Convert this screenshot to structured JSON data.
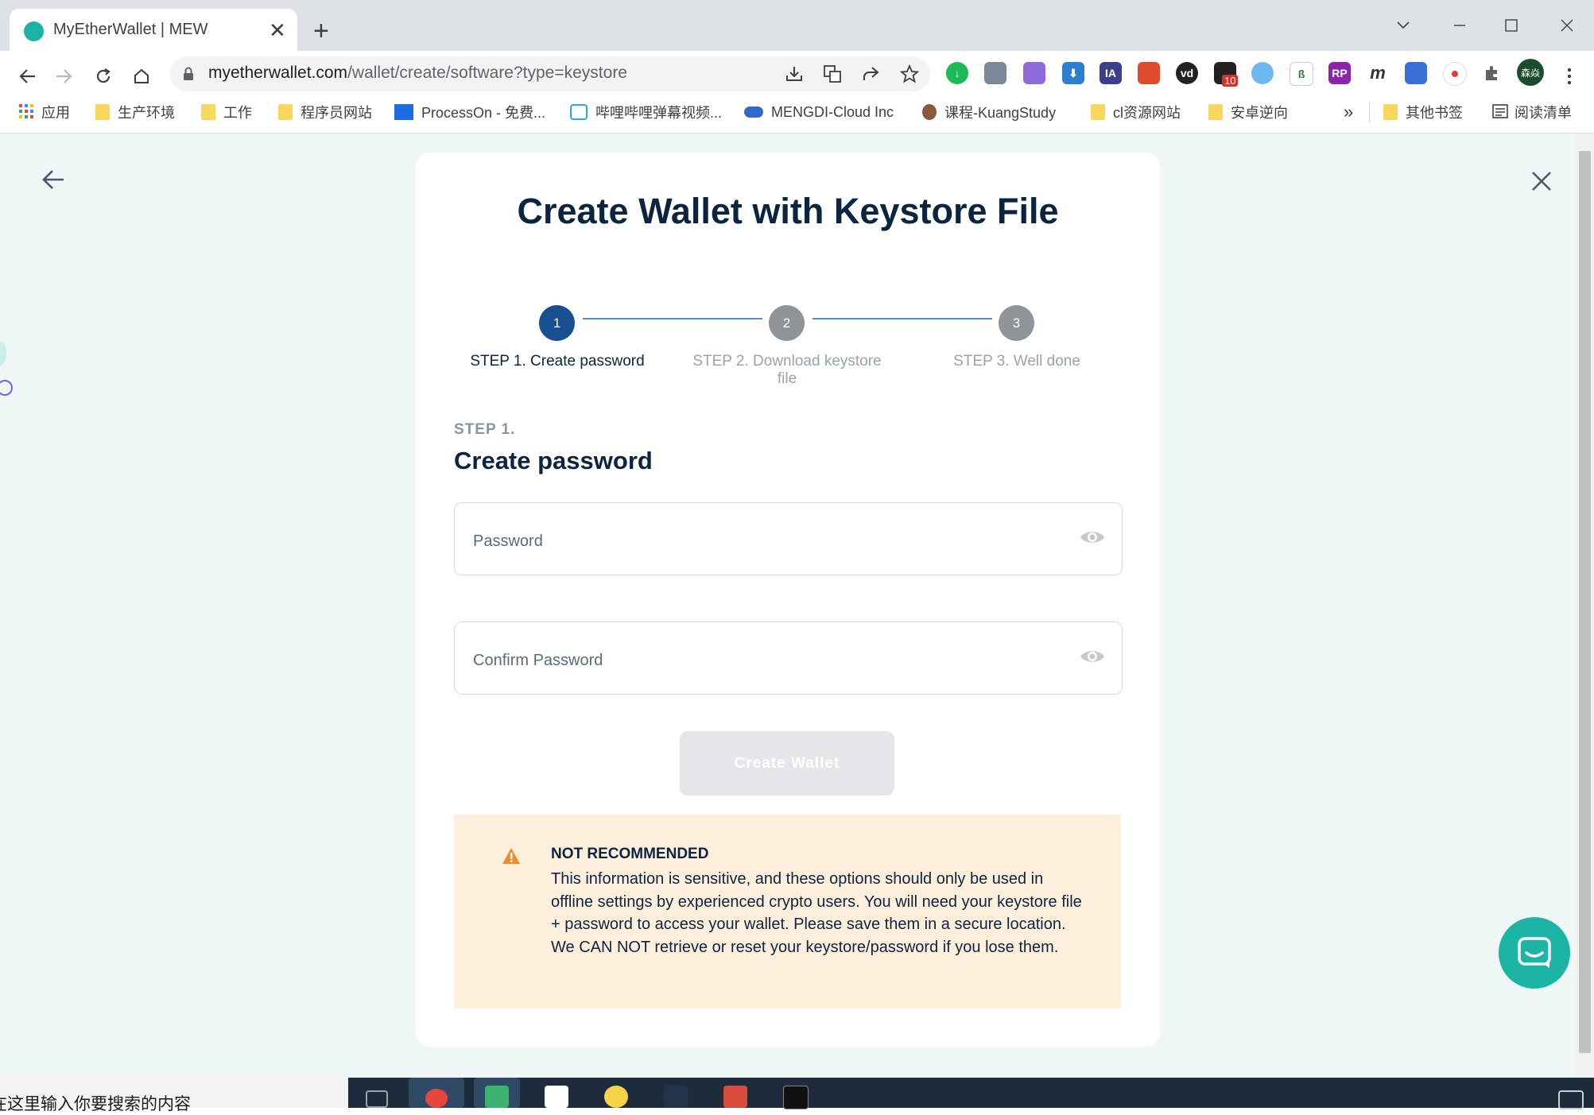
{
  "browser": {
    "tab_title": "MyEtherWallet | MEW",
    "tab_close": "✕",
    "new_tab": "+",
    "url_host": "myetherwallet.com",
    "url_path": "/wallet/create/software?type=keystore",
    "extension_badge": "10",
    "profile_label": "森焱"
  },
  "bookmarks": {
    "apps": "应用",
    "items": [
      "生产环境",
      "工作",
      "程序员网站",
      "ProcessOn - 免费...",
      "哔哩哔哩弹幕视频...",
      "MENGDI-Cloud Inc",
      "课程-KuangStudy",
      "cl资源网站",
      "安卓逆向"
    ],
    "overflow": "»",
    "other": "其他书签",
    "reading_list": "阅读清单"
  },
  "page": {
    "title": "Create Wallet with Keystore File",
    "steps": [
      {
        "number": "1",
        "label": "STEP 1. Create password",
        "active": true
      },
      {
        "number": "2",
        "label": "STEP 2. Download keystore file",
        "active": false
      },
      {
        "number": "3",
        "label": "STEP 3. Well done",
        "active": false
      }
    ],
    "step_kicker": "STEP 1.",
    "section_title": "Create password",
    "password_placeholder": "Password",
    "confirm_placeholder": "Confirm Password",
    "create_button": "Create Wallet",
    "alert": {
      "title": "NOT RECOMMENDED",
      "body": "This information is sensitive, and these options should only be used in offline settings by experienced crypto users. You will need your keystore file + password to access your wallet. Please save them in a secure location. We CAN NOT retrieve or reset your keystore/password if you lose them."
    }
  },
  "taskbar": {
    "search_text": "在这里输入你要搜索的内容"
  },
  "colors": {
    "accent_active_step": "#184f90",
    "inactive_step": "#8f9499",
    "page_bg": "#eef7f6",
    "alert_bg": "#fdefdc",
    "warning_icon": "#f28c28",
    "chat_bubble": "#1cb5a5"
  }
}
